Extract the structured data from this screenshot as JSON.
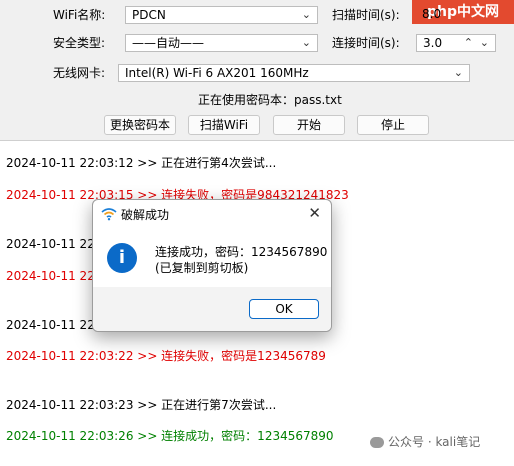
{
  "form": {
    "wifi_name_label": "WiFi名称:",
    "wifi_name_value": "PDCN",
    "scan_time_label": "扫描时间(s):",
    "scan_time_value": "8.0",
    "security_label": "安全类型:",
    "security_value": "——自动——",
    "connect_time_label": "连接时间(s):",
    "connect_time_value": "3.0",
    "wireless_card_label": "无线网卡:",
    "wireless_card_value": "Intel(R) Wi-Fi 6 AX201 160MHz",
    "current_dict_text": "正在使用密码本：pass.txt"
  },
  "buttons": {
    "change_dict": "更换密码本",
    "scan_wifi": "扫描WiFi",
    "start": "开始",
    "stop": "停止"
  },
  "log": [
    {
      "text": "2024-10-11 22:03:12 >> 正在进行第4次尝试...",
      "color": "black"
    },
    {
      "text": "2024-10-11 22:03:15 >> 连接失败，密码是984321241823",
      "color": "red"
    },
    {
      "text": "2024-10-11 22:03:1",
      "color": "black"
    },
    {
      "text": "2024-10-11 22:03:1",
      "color": "red"
    },
    {
      "text": "2024-10-11 22:",
      "color": "black"
    },
    {
      "text": "2024-10-11 22:03:22 >> 连接失败，密码是123456789",
      "color": "red"
    },
    {
      "text": "2024-10-11 22:03:23 >> 正在进行第7次尝试...",
      "color": "black"
    },
    {
      "text": "2024-10-11 22:03:26 >> 连接成功，密码：1234567890",
      "color": "green"
    }
  ],
  "dialog": {
    "title": "破解成功",
    "close": "✕",
    "line1": "连接成功，密码：1234567890",
    "line2": "(已复制到剪切板)",
    "ok": "OK",
    "icon_text": "i"
  },
  "watermark": {
    "text": "公众号 · kali笔记",
    "badge": "php中文网"
  }
}
